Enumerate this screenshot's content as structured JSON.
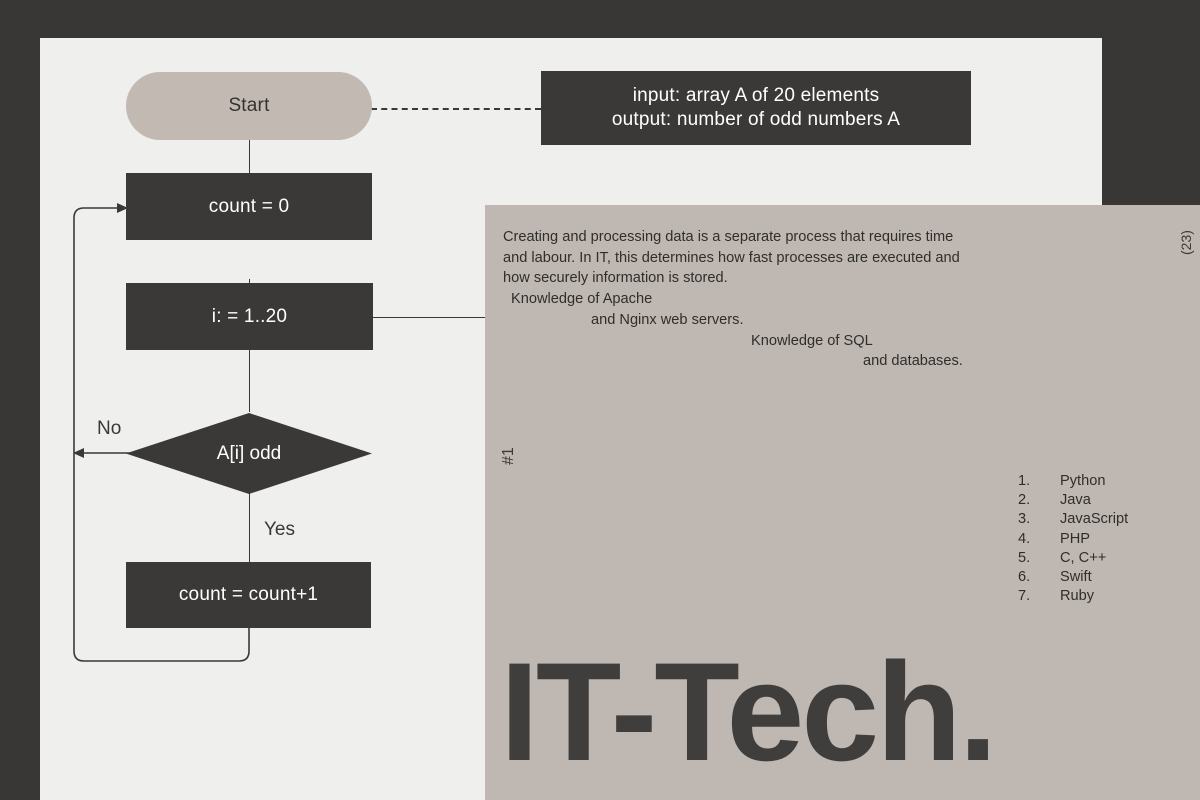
{
  "theme": {
    "background": "#383735",
    "light_panel": "#efefee",
    "beige_panel": "#bfb7b1",
    "node_fill": "#3a3937",
    "node_text": "#ffffff",
    "terminator_fill": "#c2b9b3",
    "body_text": "#2f2e2c"
  },
  "flowchart": {
    "nodes": {
      "start": {
        "label": "Start",
        "shape": "terminator"
      },
      "init": {
        "label": "count = 0",
        "shape": "process"
      },
      "loop": {
        "label": "i: = 1..20",
        "shape": "process"
      },
      "decision": {
        "label": "A[i] odd",
        "shape": "decision"
      },
      "increment": {
        "label": "count = count+1",
        "shape": "process"
      }
    },
    "note": {
      "line1": "input: array A of 20 elements",
      "line2": "output: number of odd numbers A"
    },
    "edge_labels": {
      "no": "No",
      "yes": "Yes"
    }
  },
  "article": {
    "paragraph": [
      "Creating and processing data is a separate process that requires time",
      "and labour. In IT, this determines how fast processes are executed and",
      "how securely information is stored.",
      "Knowledge of Apache",
      "and Nginx web servers.",
      "Knowledge of SQL",
      "and databases."
    ],
    "marker_hash": "#1",
    "page_number": "(23)",
    "languages": [
      {
        "num": "1.",
        "name": "Python"
      },
      {
        "num": "2.",
        "name": "Java"
      },
      {
        "num": "3.",
        "name": "JavaScript"
      },
      {
        "num": "4.",
        "name": "PHP"
      },
      {
        "num": "5.",
        "name": "C, C++"
      },
      {
        "num": "6.",
        "name": "Swift"
      },
      {
        "num": "7.",
        "name": "Ruby"
      }
    ],
    "wordmark": "IT-Tech."
  }
}
